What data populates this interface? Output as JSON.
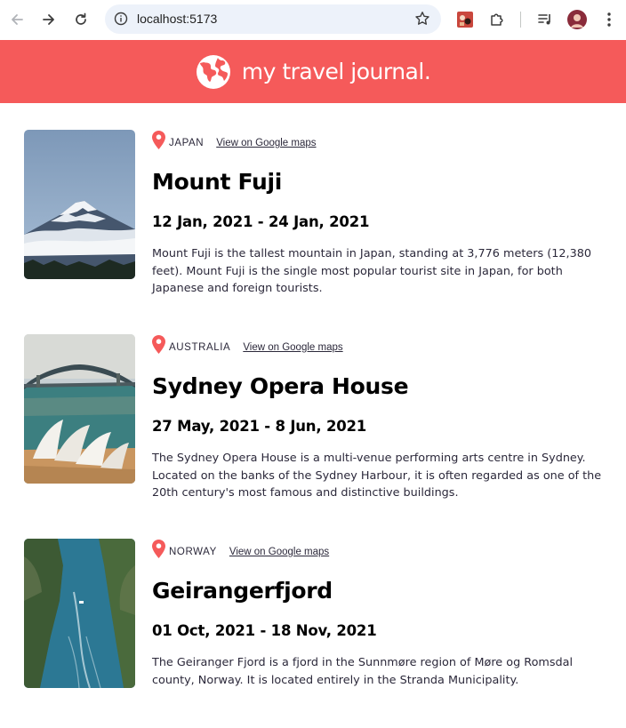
{
  "browser": {
    "url": "localhost:5173"
  },
  "header": {
    "title": "my travel journal.",
    "color": "#F55A5A"
  },
  "entries": [
    {
      "country": "JAPAN",
      "map_link": "View on Google maps",
      "title": "Mount Fuji",
      "dates": "12 Jan, 2021 - 24 Jan, 2021",
      "description": "Mount Fuji is the tallest mountain in Japan, standing at 3,776 meters (12,380 feet). Mount Fuji is the single most popular tourist site in Japan, for both Japanese and foreign tourists."
    },
    {
      "country": "AUSTRALIA",
      "map_link": "View on Google maps",
      "title": "Sydney Opera House",
      "dates": "27 May, 2021 - 8 Jun, 2021",
      "description": "The Sydney Opera House is a multi-venue performing arts centre in Sydney. Located on the banks of the Sydney Harbour, it is often regarded as one of the 20th century's most famous and distinctive buildings."
    },
    {
      "country": "NORWAY",
      "map_link": "View on Google maps",
      "title": "Geirangerfjord",
      "dates": "01 Oct, 2021 - 18 Nov, 2021",
      "description": "The Geiranger Fjord is a fjord in the Sunnmøre region of Møre og Romsdal county, Norway. It is located entirely in the Stranda Municipality."
    }
  ]
}
